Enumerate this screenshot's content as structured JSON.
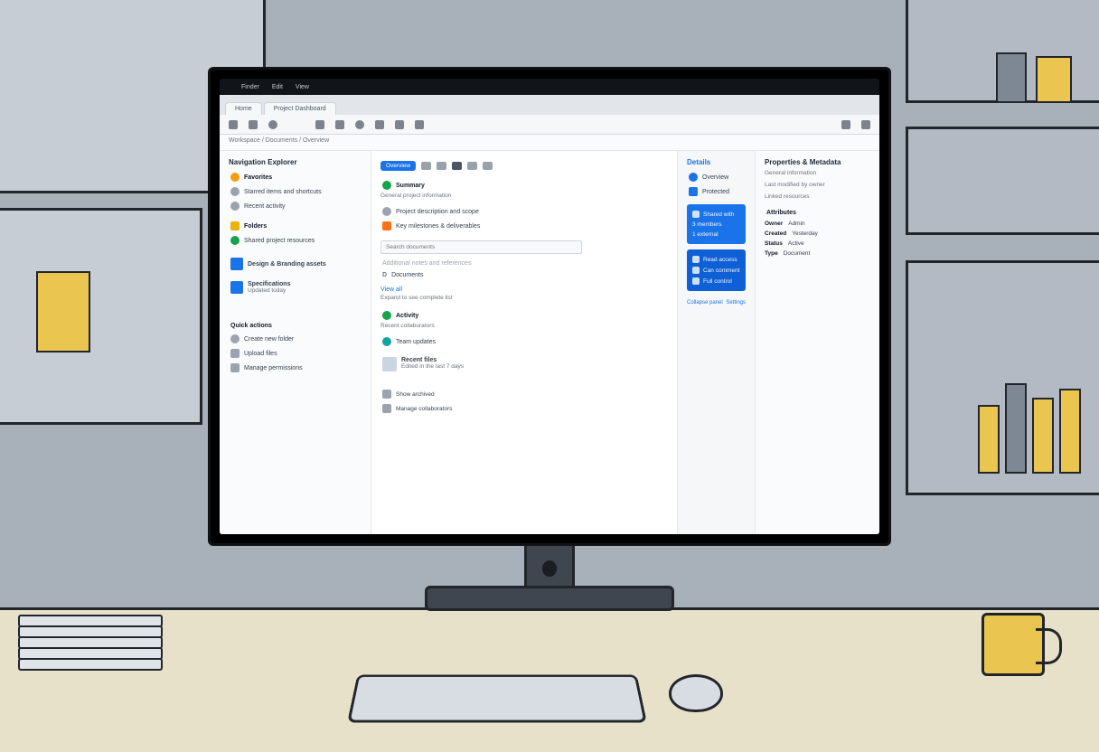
{
  "macbar": {
    "apple": "",
    "menu1": "Finder",
    "menu2": "Edit",
    "menu3": "View"
  },
  "tabs": [
    "Home",
    "Project Dashboard"
  ],
  "toolbar_icons": [
    "back-icon",
    "forward-icon",
    "refresh-icon",
    "app-icon",
    "share-icon",
    "tag-icon",
    "pin-icon",
    "more-icon",
    "grid-icon",
    "list-icon"
  ],
  "crumb": "Workspace / Documents / Overview",
  "left": {
    "title": "Navigation Explorer",
    "group1": "Favorites",
    "items1": [
      "Starred items and shortcuts",
      "Recent activity"
    ],
    "group2": "Folders",
    "items2": [
      "Shared project resources"
    ],
    "tiles": [
      {
        "label": "Design & Branding assets"
      },
      {
        "label": "Specifications",
        "sub": "Updated today"
      }
    ],
    "footer_title": "Quick actions",
    "footer_items": [
      "Create new folder",
      "Upload files",
      "Manage permissions"
    ]
  },
  "center": {
    "pill": "Overview",
    "section1": "Summary",
    "section1_sub": "General project information",
    "rows1": [
      "Project description and scope",
      "Key milestones & deliverables"
    ],
    "field_label": "Search documents",
    "row_muted": "Additional notes and references",
    "row_d": "D",
    "row_d_text": "Documents",
    "link": "View all",
    "link_sub": "Expand to see complete list",
    "section2": "Activity",
    "section2_sub": "Recent collaborators",
    "row_green": "Team updates",
    "block_title": "Recent files",
    "block_sub": "Edited in the last 7 days",
    "foot1": "Show archived",
    "foot2": "Manage collaborators"
  },
  "rail": {
    "title": "Details",
    "row_icon": "Overview",
    "row_shield": "Protected",
    "card1": {
      "title": "Shared with",
      "rows": [
        "3 members",
        "1 external"
      ]
    },
    "card2": {
      "rows": [
        "Read access",
        "Can comment",
        "Full control"
      ]
    },
    "foot_l": "Collapse panel",
    "foot_r": "Settings"
  },
  "far": {
    "title": "Properties & Metadata",
    "sub1": "General information",
    "sub2": "Last modified by owner",
    "sub3": "Linked resources",
    "group": "Attributes",
    "kv": [
      [
        "Owner",
        "Admin"
      ],
      [
        "Created",
        "Yesterday"
      ],
      [
        "Status",
        "Active"
      ],
      [
        "Type",
        "Document"
      ]
    ]
  }
}
